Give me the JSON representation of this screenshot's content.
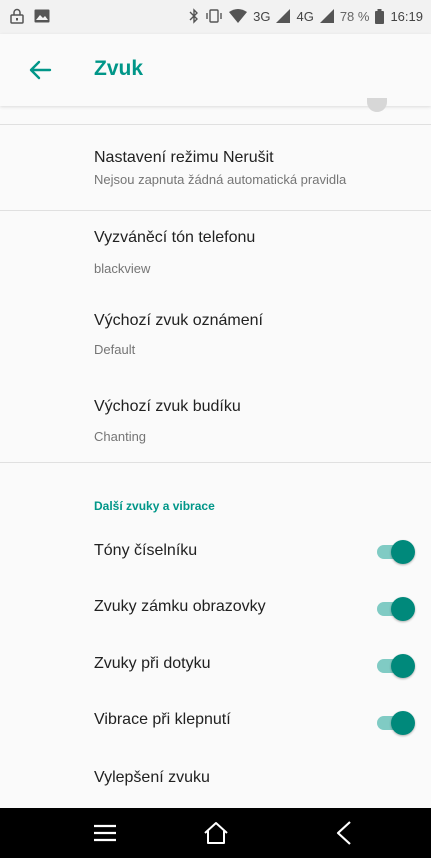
{
  "status_bar": {
    "network_3g": "3G",
    "network_4g": "4G",
    "battery_percent": "78 %",
    "time": "16:19"
  },
  "app_bar": {
    "title": "Zvuk"
  },
  "items": [
    {
      "title": "Nastavení režimu Nerušit",
      "subtitle": "Nejsou zapnuta žádná automatická pravidla"
    },
    {
      "title": "Vyzváněcí tón telefonu",
      "subtitle": "blackview"
    },
    {
      "title": "Výchozí zvuk oznámení",
      "subtitle": "Default"
    },
    {
      "title": "Výchozí zvuk budíku",
      "subtitle": "Chanting"
    }
  ],
  "section_header": "Další zvuky a vibrace",
  "toggles": [
    {
      "label": "Tóny číselníku",
      "on": true
    },
    {
      "label": "Zvuky zámku obrazovky",
      "on": true
    },
    {
      "label": "Zvuky při dotyku",
      "on": true
    },
    {
      "label": "Vibrace při klepnutí",
      "on": true
    }
  ],
  "last_item": {
    "title": "Vylepšení zvuku"
  },
  "colors": {
    "accent": "#009688",
    "toggle_thumb": "#00897b",
    "toggle_track": "#80cbc4"
  }
}
